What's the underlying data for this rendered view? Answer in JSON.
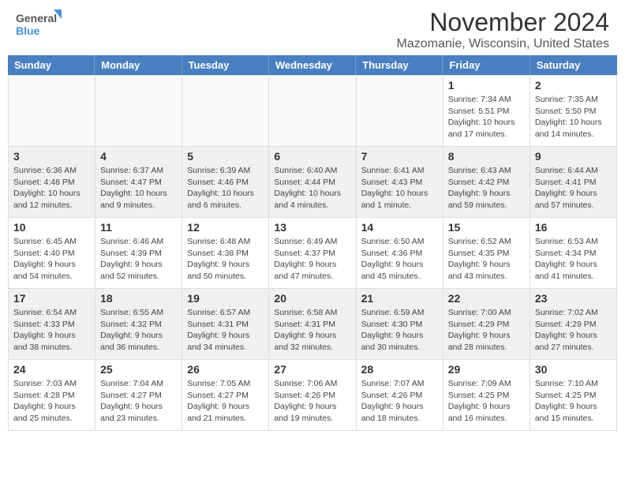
{
  "header": {
    "logo_general": "General",
    "logo_blue": "Blue",
    "title": "November 2024",
    "subtitle": "Mazomanie, Wisconsin, United States"
  },
  "calendar": {
    "days_of_week": [
      "Sunday",
      "Monday",
      "Tuesday",
      "Wednesday",
      "Thursday",
      "Friday",
      "Saturday"
    ],
    "weeks": [
      [
        {
          "day": "",
          "info": "",
          "empty": true
        },
        {
          "day": "",
          "info": "",
          "empty": true
        },
        {
          "day": "",
          "info": "",
          "empty": true
        },
        {
          "day": "",
          "info": "",
          "empty": true
        },
        {
          "day": "",
          "info": "",
          "empty": true
        },
        {
          "day": "1",
          "info": "Sunrise: 7:34 AM\nSunset: 5:51 PM\nDaylight: 10 hours\nand 17 minutes."
        },
        {
          "day": "2",
          "info": "Sunrise: 7:35 AM\nSunset: 5:50 PM\nDaylight: 10 hours\nand 14 minutes."
        }
      ],
      [
        {
          "day": "3",
          "info": "Sunrise: 6:36 AM\nSunset: 4:48 PM\nDaylight: 10 hours\nand 12 minutes."
        },
        {
          "day": "4",
          "info": "Sunrise: 6:37 AM\nSunset: 4:47 PM\nDaylight: 10 hours\nand 9 minutes."
        },
        {
          "day": "5",
          "info": "Sunrise: 6:39 AM\nSunset: 4:46 PM\nDaylight: 10 hours\nand 6 minutes."
        },
        {
          "day": "6",
          "info": "Sunrise: 6:40 AM\nSunset: 4:44 PM\nDaylight: 10 hours\nand 4 minutes."
        },
        {
          "day": "7",
          "info": "Sunrise: 6:41 AM\nSunset: 4:43 PM\nDaylight: 10 hours\nand 1 minute."
        },
        {
          "day": "8",
          "info": "Sunrise: 6:43 AM\nSunset: 4:42 PM\nDaylight: 9 hours\nand 59 minutes."
        },
        {
          "day": "9",
          "info": "Sunrise: 6:44 AM\nSunset: 4:41 PM\nDaylight: 9 hours\nand 57 minutes."
        }
      ],
      [
        {
          "day": "10",
          "info": "Sunrise: 6:45 AM\nSunset: 4:40 PM\nDaylight: 9 hours\nand 54 minutes."
        },
        {
          "day": "11",
          "info": "Sunrise: 6:46 AM\nSunset: 4:39 PM\nDaylight: 9 hours\nand 52 minutes."
        },
        {
          "day": "12",
          "info": "Sunrise: 6:48 AM\nSunset: 4:38 PM\nDaylight: 9 hours\nand 50 minutes."
        },
        {
          "day": "13",
          "info": "Sunrise: 6:49 AM\nSunset: 4:37 PM\nDaylight: 9 hours\nand 47 minutes."
        },
        {
          "day": "14",
          "info": "Sunrise: 6:50 AM\nSunset: 4:36 PM\nDaylight: 9 hours\nand 45 minutes."
        },
        {
          "day": "15",
          "info": "Sunrise: 6:52 AM\nSunset: 4:35 PM\nDaylight: 9 hours\nand 43 minutes."
        },
        {
          "day": "16",
          "info": "Sunrise: 6:53 AM\nSunset: 4:34 PM\nDaylight: 9 hours\nand 41 minutes."
        }
      ],
      [
        {
          "day": "17",
          "info": "Sunrise: 6:54 AM\nSunset: 4:33 PM\nDaylight: 9 hours\nand 38 minutes."
        },
        {
          "day": "18",
          "info": "Sunrise: 6:55 AM\nSunset: 4:32 PM\nDaylight: 9 hours\nand 36 minutes."
        },
        {
          "day": "19",
          "info": "Sunrise: 6:57 AM\nSunset: 4:31 PM\nDaylight: 9 hours\nand 34 minutes."
        },
        {
          "day": "20",
          "info": "Sunrise: 6:58 AM\nSunset: 4:31 PM\nDaylight: 9 hours\nand 32 minutes."
        },
        {
          "day": "21",
          "info": "Sunrise: 6:59 AM\nSunset: 4:30 PM\nDaylight: 9 hours\nand 30 minutes."
        },
        {
          "day": "22",
          "info": "Sunrise: 7:00 AM\nSunset: 4:29 PM\nDaylight: 9 hours\nand 28 minutes."
        },
        {
          "day": "23",
          "info": "Sunrise: 7:02 AM\nSunset: 4:29 PM\nDaylight: 9 hours\nand 27 minutes."
        }
      ],
      [
        {
          "day": "24",
          "info": "Sunrise: 7:03 AM\nSunset: 4:28 PM\nDaylight: 9 hours\nand 25 minutes."
        },
        {
          "day": "25",
          "info": "Sunrise: 7:04 AM\nSunset: 4:27 PM\nDaylight: 9 hours\nand 23 minutes."
        },
        {
          "day": "26",
          "info": "Sunrise: 7:05 AM\nSunset: 4:27 PM\nDaylight: 9 hours\nand 21 minutes."
        },
        {
          "day": "27",
          "info": "Sunrise: 7:06 AM\nSunset: 4:26 PM\nDaylight: 9 hours\nand 19 minutes."
        },
        {
          "day": "28",
          "info": "Sunrise: 7:07 AM\nSunset: 4:26 PM\nDaylight: 9 hours\nand 18 minutes."
        },
        {
          "day": "29",
          "info": "Sunrise: 7:09 AM\nSunset: 4:25 PM\nDaylight: 9 hours\nand 16 minutes."
        },
        {
          "day": "30",
          "info": "Sunrise: 7:10 AM\nSunset: 4:25 PM\nDaylight: 9 hours\nand 15 minutes."
        }
      ]
    ]
  }
}
